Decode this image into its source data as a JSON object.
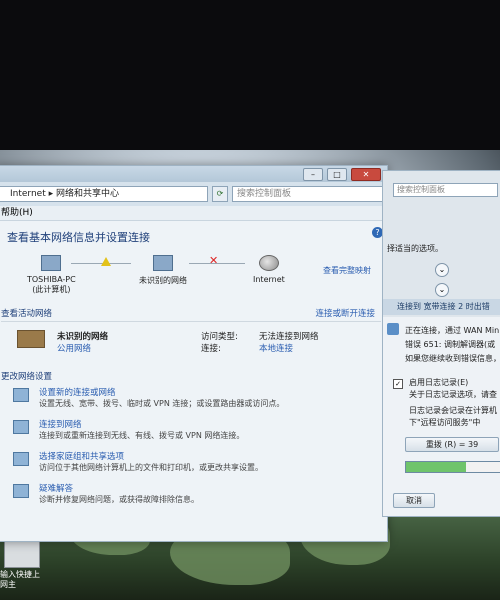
{
  "main_window": {
    "address": {
      "path_root": "Internet",
      "path_separator": "▸",
      "path_current": "网络和共享中心",
      "search_placeholder": "搜索控制面板"
    },
    "titlebar": {
      "minimize": "–",
      "maximize": "□",
      "close": "✕"
    },
    "menu": {
      "help": "帮助(H)"
    },
    "heading": "查看基本网络信息并设置连接",
    "netmap": {
      "pc_name": "TOSHIBA-PC",
      "pc_sub": "(此计算机)",
      "network": "未识别的网络",
      "internet": "Internet",
      "full_map_link": "查看完整映射"
    },
    "active_section": {
      "title": "查看活动网络",
      "connect_link": "连接或断开连接",
      "network_name": "未识别的网络",
      "network_type": "公用网络",
      "access_type_label": "访问类型:",
      "access_type_value": "无法连接到网络",
      "connection_label": "连接:",
      "connection_value": "本地连接"
    },
    "change_section": {
      "title": "更改网络设置",
      "tasks": [
        {
          "title": "设置新的连接或网络",
          "desc": "设置无线、宽带、拨号、临时或 VPN 连接；或设置路由器或访问点。"
        },
        {
          "title": "连接到网络",
          "desc": "连接到或重新连接到无线、有线、拨号或 VPN 网络连接。"
        },
        {
          "title": "选择家庭组和共享选项",
          "desc": "访问位于其他网络计算机上的文件和打印机，或更改共享设置。"
        },
        {
          "title": "疑难解答",
          "desc": "诊断并修复网络问题，或获得故障排除信息。"
        }
      ]
    }
  },
  "side_window": {
    "top_search": "搜索控制面板",
    "option_text": "择适当的选项。",
    "dialog_title": "连接到 宽带连接 2 时出错",
    "lines": [
      "正在连接，通过 WAN Mini",
      "错误 651: 调制解调器(或",
      "如果您继续收到错误信息，您"
    ],
    "log_checkbox": "启用日志记录(E)",
    "log_link": "关于日志记录选项，请查",
    "log_note_1": "日志记录会记录在计算机",
    "log_note_2": "下\"远程访问服务\"中",
    "redial": "重拨 (R) = 39",
    "cancel": "取消",
    "redial_progress": 0.6
  },
  "desktop": {
    "icon_label": "输入快捷上网主"
  }
}
